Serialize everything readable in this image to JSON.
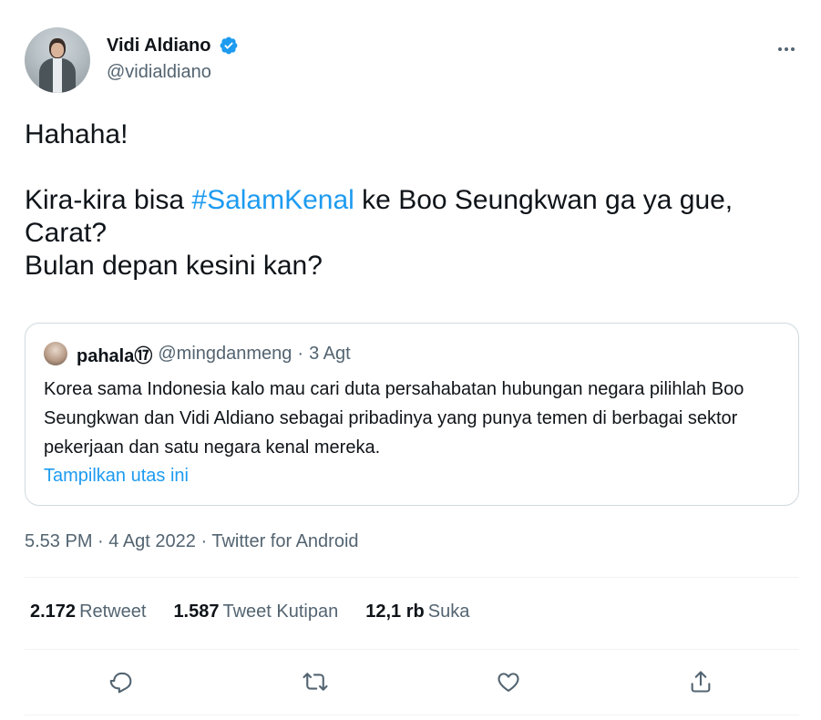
{
  "author": {
    "display_name": "Vidi Aldiano",
    "handle": "@vidialdiano",
    "verified": true
  },
  "tweet": {
    "text_intro": "Hahaha!\n\nKira-kira bisa ",
    "hashtag": "#SalamKenal",
    "text_rest": " ke Boo Seungkwan ga ya gue, Carat?\nBulan depan kesini kan?"
  },
  "quote": {
    "name": "pahala⑰",
    "handle": "@mingdanmeng",
    "separator": "·",
    "time": "3 Agt",
    "text": "Korea sama Indonesia kalo mau cari duta persahabatan hubungan negara pilihlah Boo Seungkwan dan Vidi Aldiano sebagai pribadinya yang punya temen di berbagai sektor pekerjaan dan satu negara kenal mereka.",
    "show_thread": "Tampilkan utas ini"
  },
  "meta": {
    "time": "5.53 PM",
    "sep1": " · ",
    "date": "4 Agt 2022",
    "sep2": " · ",
    "source": "Twitter for Android"
  },
  "stats": {
    "retweets_count": "2.172",
    "retweets_label": "Retweet",
    "quotes_count": "1.587",
    "quotes_label": "Tweet Kutipan",
    "likes_count": "12,1 rb",
    "likes_label": "Suka"
  },
  "icons": {
    "verified": "verified-badge-icon",
    "more": "more-icon",
    "reply": "reply-icon",
    "retweet": "retweet-icon",
    "like": "like-icon",
    "share": "share-icon"
  },
  "colors": {
    "accent": "#1d9bf0",
    "text": "#0f1419",
    "secondary": "#536471",
    "border": "#cfd9de"
  }
}
